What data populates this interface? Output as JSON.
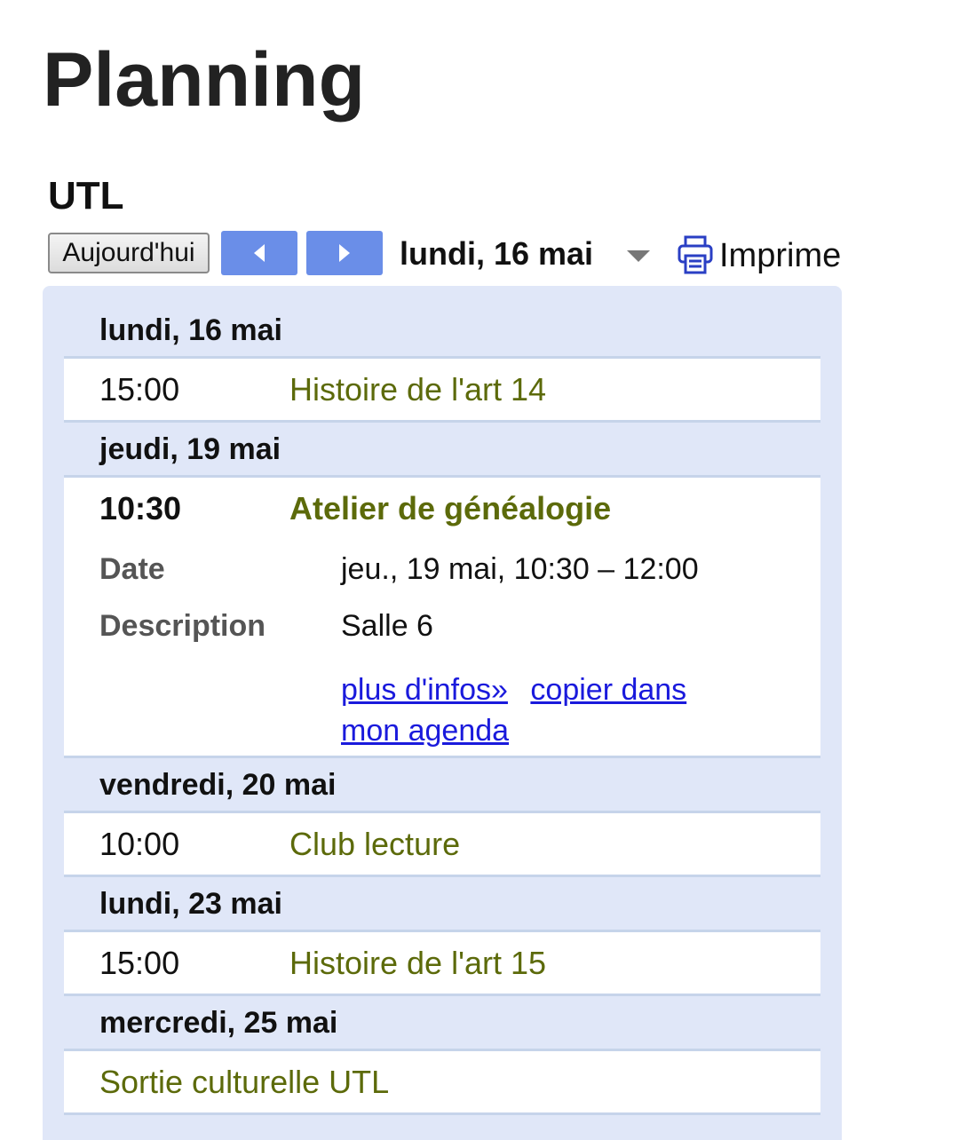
{
  "page": {
    "title": "Planning"
  },
  "calendar": {
    "name": "UTL"
  },
  "toolbar": {
    "today_label": "Aujourd'hui",
    "prev_icon": "chevron-left-icon",
    "next_icon": "chevron-right-icon",
    "range_label": "lundi, 16 mai",
    "dropdown_icon": "caret-down-icon",
    "print_icon": "printer-icon",
    "print_label": "Imprimer"
  },
  "colors": {
    "nav_button": "#6a8ee8",
    "agenda_background": "#e0e7f8",
    "event_title": "#5c6a0a",
    "link": "#1a1adc"
  },
  "agenda": {
    "days": [
      {
        "header": "lundi, 16 mai",
        "events": [
          {
            "time": "15:00",
            "title": "Histoire de l'art 14"
          }
        ]
      },
      {
        "header": "jeudi, 19 mai",
        "events": [
          {
            "time": "10:30",
            "title": "Atelier de généalogie",
            "expanded": true,
            "date_label": "Date",
            "date_value": "jeu., 19 mai, 10:30 – 12:00",
            "description_label": "Description",
            "description_value": "Salle 6",
            "more_info_link": "plus d'infos»",
            "copy_link": "copier dans mon agenda"
          }
        ]
      },
      {
        "header": "vendredi, 20 mai",
        "events": [
          {
            "time": "10:00",
            "title": "Club lecture"
          }
        ]
      },
      {
        "header": "lundi, 23 mai",
        "events": [
          {
            "time": "15:00",
            "title": "Histoire de l'art 15"
          }
        ]
      },
      {
        "header": "mercredi, 25 mai",
        "events": [
          {
            "time": "",
            "title": "Sortie culturelle UTL"
          }
        ]
      }
    ]
  }
}
